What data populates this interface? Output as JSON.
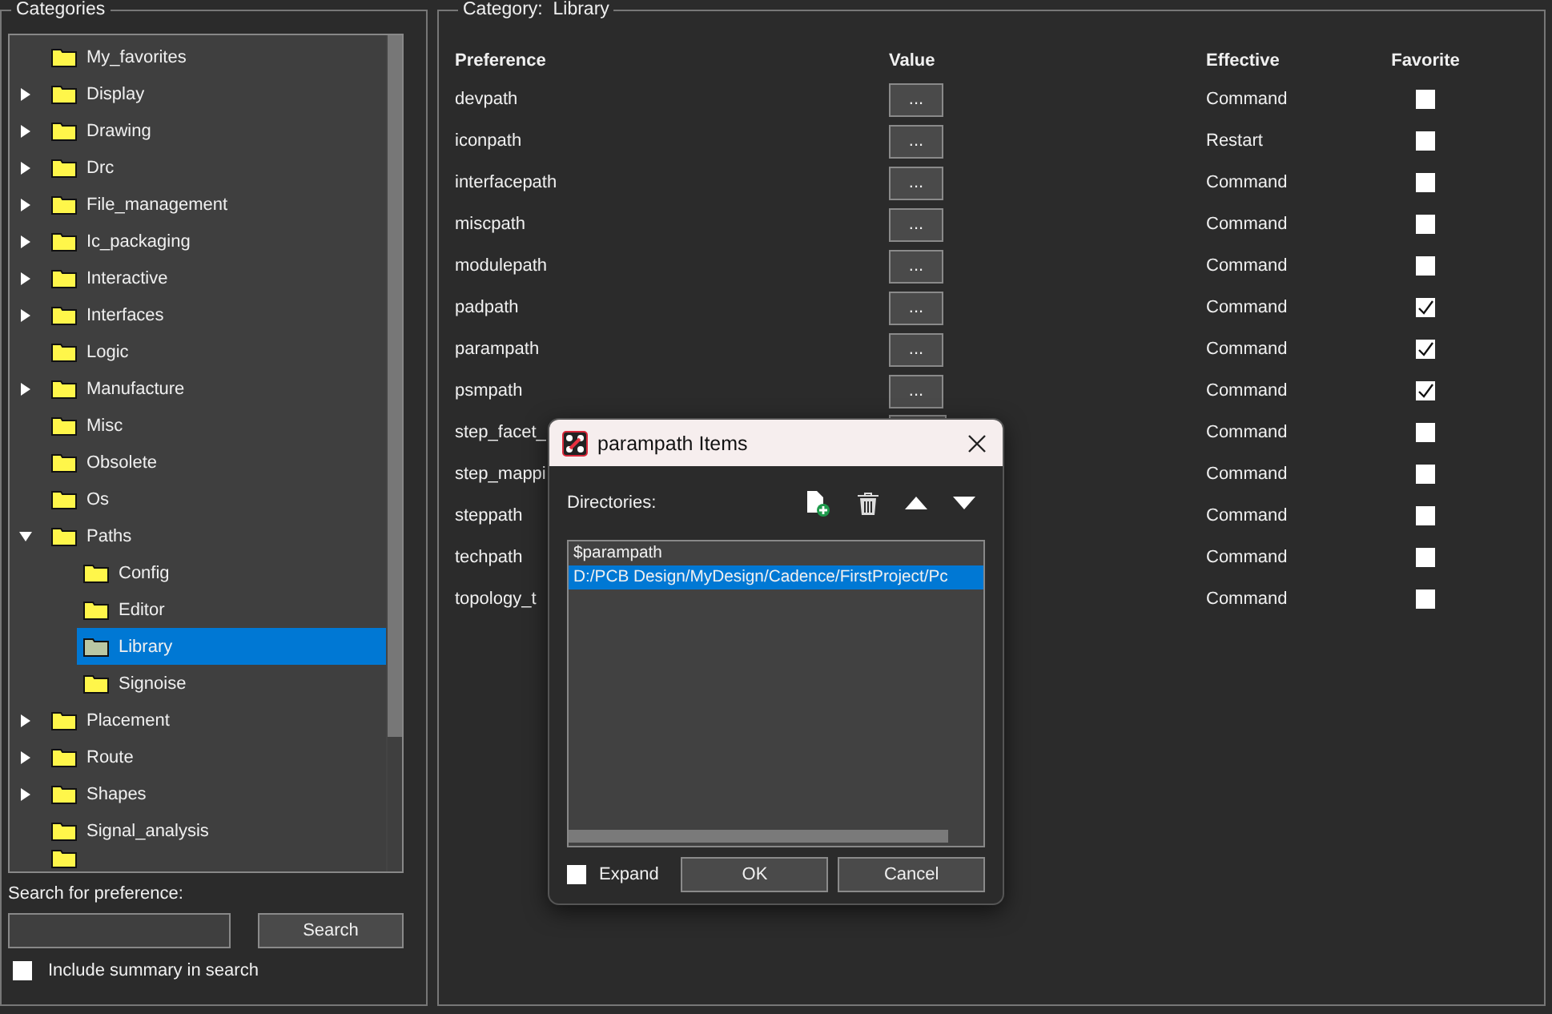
{
  "categories": {
    "title": "Categories",
    "tree": [
      {
        "label": "My_favorites",
        "selected": false
      },
      {
        "label": "Display",
        "expanded": false,
        "selected": false
      },
      {
        "label": "Drawing",
        "expanded": false,
        "selected": false
      },
      {
        "label": "Drc",
        "expanded": false,
        "selected": false
      },
      {
        "label": "File_management",
        "expanded": false,
        "selected": false
      },
      {
        "label": "Ic_packaging",
        "expanded": false,
        "selected": false
      },
      {
        "label": "Interactive",
        "expanded": false,
        "selected": false
      },
      {
        "label": "Interfaces",
        "expanded": false,
        "selected": false
      },
      {
        "label": "Logic",
        "selected": false
      },
      {
        "label": "Manufacture",
        "expanded": false,
        "selected": false
      },
      {
        "label": "Misc",
        "selected": false
      },
      {
        "label": "Obsolete",
        "selected": false
      },
      {
        "label": "Os",
        "selected": false
      },
      {
        "label": "Paths",
        "expanded": true,
        "selected": false,
        "children": [
          {
            "label": "Config",
            "selected": false
          },
          {
            "label": "Editor",
            "selected": false
          },
          {
            "label": "Library",
            "selected": true
          },
          {
            "label": "Signoise",
            "selected": false
          }
        ]
      },
      {
        "label": "Placement",
        "expanded": false,
        "selected": false
      },
      {
        "label": "Route",
        "expanded": false,
        "selected": false
      },
      {
        "label": "Shapes",
        "expanded": false,
        "selected": false
      },
      {
        "label": "Signal_analysis",
        "selected": false
      }
    ],
    "search_label": "Search for preference:",
    "search_button": "Search",
    "include_summary": {
      "label": "Include summary in search",
      "checked": false
    }
  },
  "category": {
    "label": "Category:",
    "value": "Library",
    "columns": [
      "Preference",
      "Value",
      "Effective",
      "Favorite"
    ],
    "rows": [
      {
        "preference": "devpath",
        "value": "...",
        "effective": "Command",
        "favorite": false
      },
      {
        "preference": "iconpath",
        "value": "...",
        "effective": "Restart",
        "favorite": false
      },
      {
        "preference": "interfacepath",
        "value": "...",
        "effective": "Command",
        "favorite": false
      },
      {
        "preference": "miscpath",
        "value": "...",
        "effective": "Command",
        "favorite": false
      },
      {
        "preference": "modulepath",
        "value": "...",
        "effective": "Command",
        "favorite": false
      },
      {
        "preference": "padpath",
        "value": "...",
        "effective": "Command",
        "favorite": true
      },
      {
        "preference": "parampath",
        "value": "...",
        "effective": "Command",
        "favorite": true
      },
      {
        "preference": "psmpath",
        "value": "...",
        "effective": "Command",
        "favorite": true
      },
      {
        "preference": "step_facet_",
        "effective": "Command",
        "favorite": false
      },
      {
        "preference": "step_mappi",
        "effective": "Command",
        "favorite": false
      },
      {
        "preference": "steppath",
        "effective": "Command",
        "favorite": false
      },
      {
        "preference": "techpath",
        "effective": "Command",
        "favorite": false
      },
      {
        "preference": "topology_t",
        "effective": "Command",
        "favorite": false
      }
    ]
  },
  "dialog": {
    "title": "parampath Items",
    "directories_label": "Directories:",
    "items": [
      {
        "text": "$parampath",
        "selected": false
      },
      {
        "text": "D:/PCB Design/MyDesign/Cadence/FirstProject/Pc",
        "selected": true
      }
    ],
    "expand": {
      "label": "Expand",
      "checked": false
    },
    "buttons": [
      "OK",
      "Cancel"
    ]
  }
}
